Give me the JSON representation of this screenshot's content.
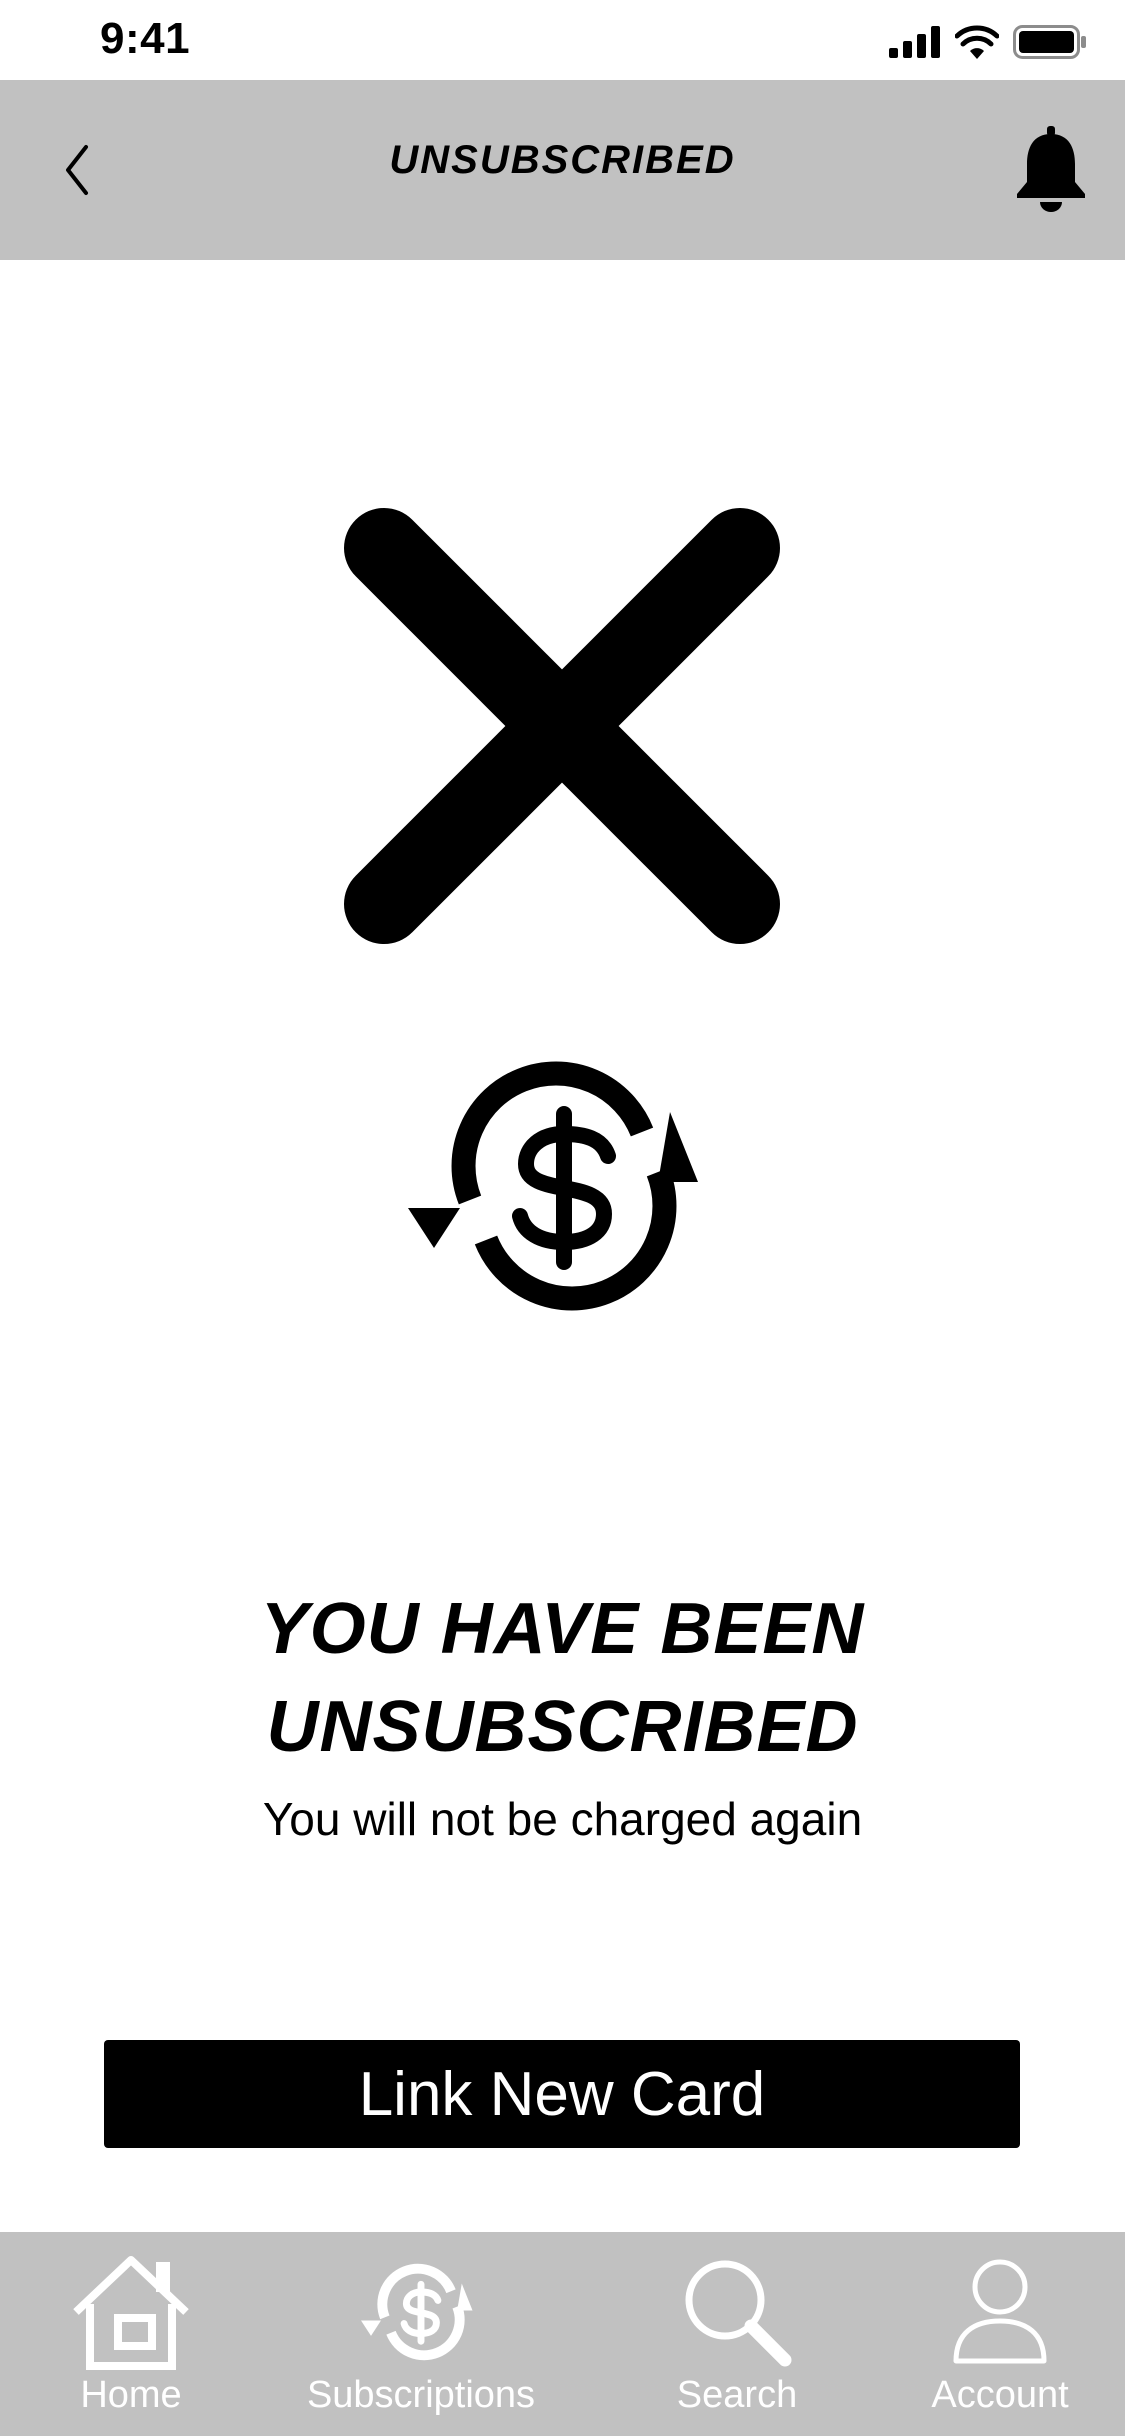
{
  "status_bar": {
    "time": "9:41"
  },
  "header": {
    "title": "UNSUBSCRIBED"
  },
  "main": {
    "headline_line1": "YOU HAVE BEEN",
    "headline_line2": "UNSUBSCRIBED",
    "subtext": "You will not be charged again",
    "primary_button_label": "Link New Card"
  },
  "tab_bar": {
    "tabs": [
      {
        "label": "Home",
        "icon": "home-icon"
      },
      {
        "label": "Subscriptions",
        "icon": "subscriptions-icon"
      },
      {
        "label": "Search",
        "icon": "search-icon"
      },
      {
        "label": "Account",
        "icon": "account-icon"
      }
    ]
  },
  "colors": {
    "header_bg": "#c1c1c1",
    "tab_bar_bg": "#c1c1c1",
    "button_bg": "#000000",
    "tab_label": "#ffffff"
  }
}
